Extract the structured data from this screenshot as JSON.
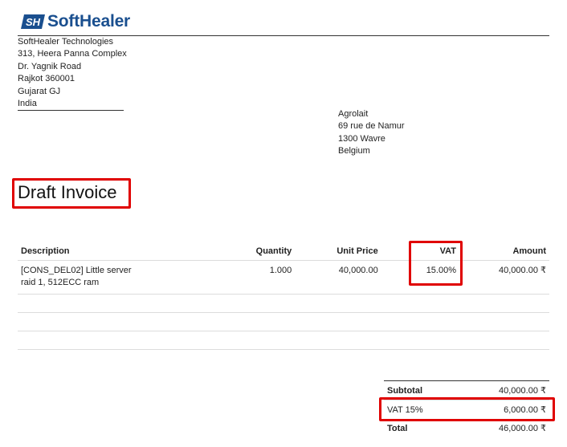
{
  "logo": {
    "text": "SoftHealer",
    "brand_color": "#1a4f8f",
    "icon": "softhealer-logo-icon"
  },
  "company": {
    "lines": [
      "SoftHealer Technologies",
      "313, Heera Panna Complex",
      "Dr. Yagnik Road",
      "Rajkot 360001",
      "Gujarat GJ",
      "India"
    ]
  },
  "customer": {
    "lines": [
      "Agrolait",
      "69 rue de Namur",
      "1300 Wavre",
      "Belgium"
    ]
  },
  "title": "Draft Invoice",
  "table": {
    "headers": {
      "description": "Description",
      "quantity": "Quantity",
      "unit_price": "Unit Price",
      "vat": "VAT",
      "amount": "Amount"
    },
    "rows": [
      {
        "description_line1": "[CONS_DEL02] Little server",
        "description_line2": "raid 1, 512ECC ram",
        "quantity": "1.000",
        "unit_price": "40,000.00",
        "vat": "15.00%",
        "amount": "40,000.00 ₹"
      }
    ]
  },
  "totals": {
    "subtotal_label": "Subtotal",
    "subtotal_value": "40,000.00 ₹",
    "tax_label": "VAT 15%",
    "tax_value": "6,000.00 ₹",
    "total_label": "Total",
    "total_value": "46,000.00 ₹"
  },
  "highlight_color": "#e00000"
}
